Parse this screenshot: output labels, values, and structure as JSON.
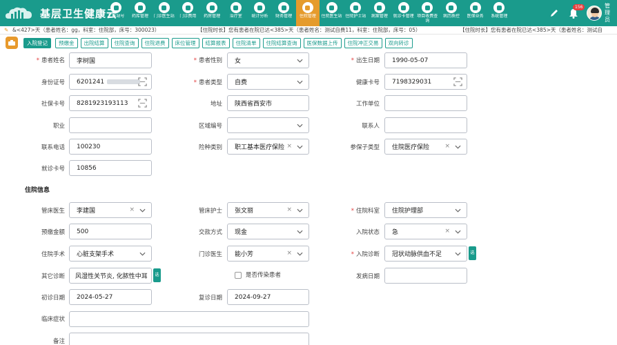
{
  "app": {
    "title": "基层卫生健康云"
  },
  "modules": [
    {
      "label": "工作站号",
      "active": false
    },
    {
      "label": "药库管理",
      "active": false
    },
    {
      "label": "门诊医生站",
      "active": false
    },
    {
      "label": "门诊费用",
      "active": false
    },
    {
      "label": "药房管理",
      "active": false
    },
    {
      "label": "治疗室",
      "active": false
    },
    {
      "label": "统计分析",
      "active": false
    },
    {
      "label": "财务管理",
      "active": false
    },
    {
      "label": "住院管理",
      "active": true
    },
    {
      "label": "住院医生站",
      "active": false
    },
    {
      "label": "住院护士站",
      "active": false
    },
    {
      "label": "病案管理",
      "active": false
    },
    {
      "label": "就诊卡管理",
      "active": false
    },
    {
      "label": "项目收费查询",
      "active": false
    },
    {
      "label": "病历质控",
      "active": false
    },
    {
      "label": "医保业务",
      "active": false
    },
    {
      "label": "系统管理",
      "active": false
    }
  ],
  "header": {
    "notif_count": "156",
    "user_name": "管理员"
  },
  "ticker": {
    "t1": "&<427>天（患者姓名：gg，科室：住院部，床号：300023）",
    "t2": "【住院时长】您有患者在院已达<385>天（患者姓名：测试自费11，科室：住院部，床号：05）",
    "t3": "【住院时长】您有患者在院已达<385>天（患者姓名：测试自"
  },
  "toolbar": {
    "buttons": [
      "入院登记",
      "预缴金",
      "出院结算",
      "住院查询",
      "住院退费",
      "床位管理",
      "结算报表",
      "住院清单",
      "住院结算查询",
      "医保数据上传",
      "住院冲正交易",
      "双向转诊"
    ]
  },
  "patient": {
    "name_label": "患者姓名",
    "name": "李树国",
    "gender_label": "患者性别",
    "gender": "女",
    "birth_label": "出生日期",
    "birth": "1990-05-07",
    "idcard_label": "身份证号",
    "idcard": "6201241",
    "ptype_label": "患者类型",
    "ptype": "自费",
    "health_label": "健康卡号",
    "health": "7198329031",
    "social_label": "社保卡号",
    "social": "8281923193113",
    "address_label": "地址",
    "address": "陕西省西安市",
    "work_label": "工作单位",
    "work": "",
    "job_label": "职业",
    "job": "",
    "area_label": "区域编号",
    "area": "",
    "contact_label": "联系人",
    "contact": "",
    "phone_label": "联系电话",
    "phone": "100230",
    "insure_label": "险种类别",
    "insure": "职工基本医疗保险",
    "ptype2_label": "参保子类型",
    "ptype2": "住院医疗保险",
    "visit_label": "就诊卡号",
    "visit": "10856"
  },
  "inpatient": {
    "section_title": "住院信息",
    "doctor_label": "管床医生",
    "doctor": "李建国",
    "nurse_label": "管床护士",
    "nurse": "张文丽",
    "dept_label": "住院科室",
    "dept": "住院护理部",
    "prepay_label": "预缴金额",
    "prepay": "500",
    "pay_label": "交款方式",
    "pay": "现金",
    "status_label": "入院状态",
    "status": "急",
    "surgery_label": "住院手术",
    "surgery": "心脏支架手术",
    "outdoc_label": "门诊医生",
    "outdoc": "能小芳",
    "diag_label": "入院诊断",
    "diag": "冠状动脉供血不足",
    "diag_btn": "选",
    "other_label": "其它诊断",
    "other": "风湿性关节炎, 化脓性中耳",
    "other_btn": "选",
    "infect_label": "是否传染患者",
    "onset_label": "发病日期",
    "onset": "",
    "first_label": "初诊日期",
    "first": "2024-05-27",
    "review_label": "复诊日期",
    "review": "2024-09-27",
    "symptom_label": "临床症状",
    "symptom": "",
    "remark_label": "备注",
    "remark": ""
  },
  "colors": {
    "primary": "#1a9b8c",
    "accent": "#e59b2c",
    "required": "#e23c3c"
  }
}
